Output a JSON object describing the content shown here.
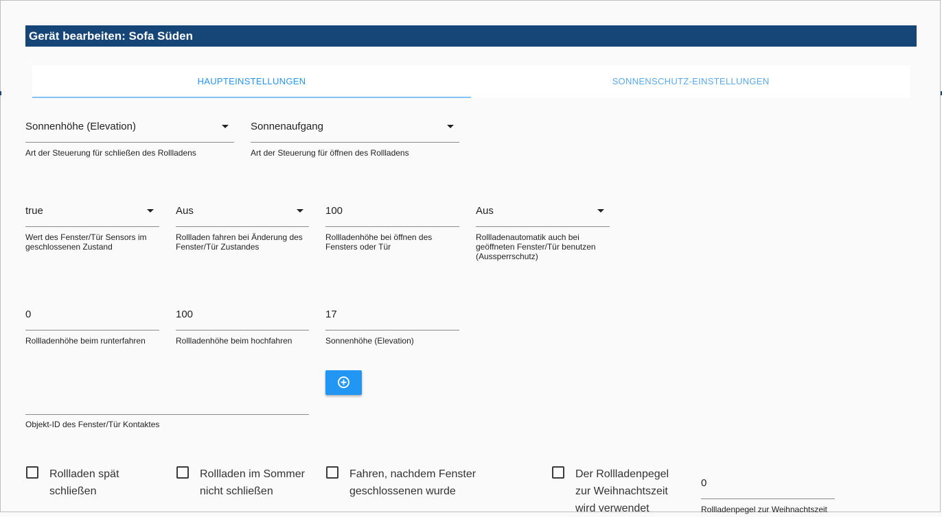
{
  "dialog": {
    "title": "Gerät bearbeiten: Sofa Süden"
  },
  "tabs": [
    {
      "label": "HAUPTEINSTELLUNGEN"
    },
    {
      "label": "SONNENSCHUTZ-EINSTELLUNGEN"
    }
  ],
  "fields": {
    "close_type": {
      "value": "Sonnenhöhe (Elevation)",
      "help": "Art der Steuerung für schließen des Rollladens"
    },
    "open_type": {
      "value": "Sonnenaufgang",
      "help": "Art der Steuerung für öffnen des Rollladens"
    },
    "sensor_value": {
      "value": "true",
      "help": "Wert des Fenster/Tür Sensors im geschlossenen Zustand"
    },
    "move_on_change": {
      "value": "Aus",
      "help": "Rollladen fahren bei Änderung des Fenster/Tür Zustandes"
    },
    "height_on_open": {
      "value": "100",
      "help": "Rollladenhöhe bei öffnen des Fensters oder Tür"
    },
    "lockout": {
      "value": "Aus",
      "help": "Rollladenautomatik auch bei geöffneten Fenster/Tür benutzen (Aussperrschutz)"
    },
    "height_down": {
      "value": "0",
      "help": "Rollladenhöhe beim runterfahren"
    },
    "height_up": {
      "value": "100",
      "help": "Rollladenhöhe beim hochfahren"
    },
    "elevation": {
      "value": "17",
      "help": "Sonnenhöhe (Elevation)"
    },
    "contact_id": {
      "value": "",
      "help": "Objekt-ID des Fenster/Tür Kontaktes"
    },
    "xmas_level": {
      "value": "0",
      "help": "Rollladenpegel zur Weihnachtszeit"
    }
  },
  "checkboxes": [
    {
      "line1": "Rollladen spät",
      "line2": "schließen",
      "line3": ""
    },
    {
      "line1": "Rollladen im Sommer",
      "line2": "nicht schließen",
      "line3": ""
    },
    {
      "line1": "Fahren, nachdem Fenster",
      "line2": "geschlossenen wurde",
      "line3": ""
    },
    {
      "line1": "Der Rollladenpegel",
      "line2": "zur Weihnachtszeit",
      "line3": "wird verwendet"
    }
  ],
  "icons": {
    "add": "plus-circle-icon",
    "dropdown": "arrow-drop-down-icon"
  },
  "colors": {
    "header": "#164677",
    "accent": "#2196f3"
  }
}
